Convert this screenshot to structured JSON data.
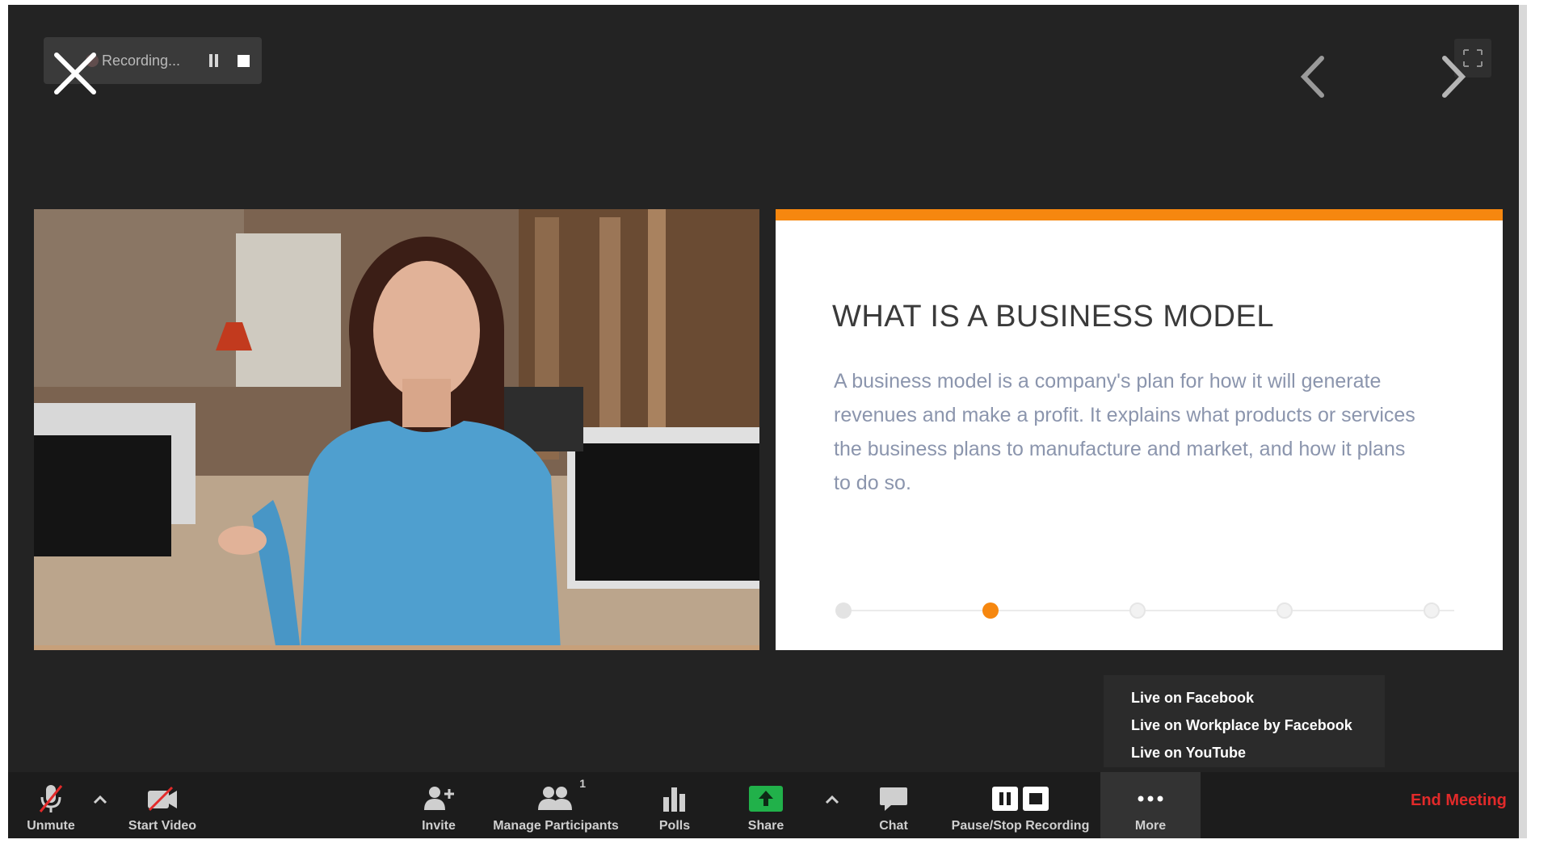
{
  "recording": {
    "status_text": "Recording..."
  },
  "slide": {
    "title": "WHAT IS A BUSINESS MODEL",
    "body": "A business model is a company's plan for how it will generate revenues and make a profit. It explains what products or services the business plans to manufacture and market, and how it plans to do so.",
    "progress": {
      "total_steps": 5,
      "current_step": 2
    },
    "accent_color": "#f6870f"
  },
  "live_menu": {
    "items": [
      "Live on Facebook",
      "Live on Workplace by Facebook",
      "Live on YouTube"
    ]
  },
  "toolbar": {
    "unmute": "Unmute",
    "start_video": "Start Video",
    "invite": "Invite",
    "manage_participants": "Manage Participants",
    "participant_count": "1",
    "polls": "Polls",
    "share": "Share",
    "chat": "Chat",
    "pause_stop_recording": "Pause/Stop Recording",
    "more": "More",
    "end_meeting": "End Meeting",
    "end_meeting_color": "#e22a2a",
    "share_color": "#21b14a"
  },
  "icons": [
    "close-icon",
    "pause-icon",
    "stop-icon",
    "chevron-left-icon",
    "chevron-right-icon",
    "fullscreen-icon",
    "muted-mic-icon",
    "video-off-icon",
    "add-user-icon",
    "participants-icon",
    "polls-icon",
    "share-screen-icon",
    "chat-icon",
    "pause-stop-recording-icon",
    "more-dots-icon",
    "caret-up-icon"
  ]
}
